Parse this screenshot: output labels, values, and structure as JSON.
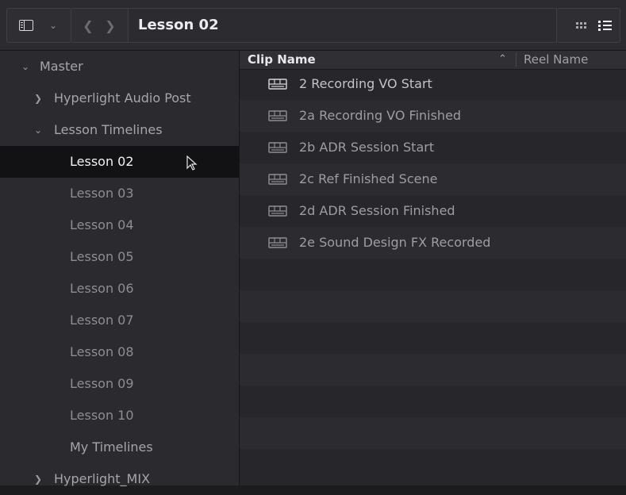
{
  "toolbar": {
    "title": "Lesson 02",
    "icons": [
      "panel-toggle-icon",
      "chevron-down-icon",
      "back-icon",
      "forward-icon",
      "grid-view-icon",
      "list-view-icon"
    ]
  },
  "sidebar": {
    "master": "Master",
    "hyperlight_audio_post": "Hyperlight Audio Post",
    "lesson_timelines": "Lesson Timelines",
    "lessons": [
      "Lesson 02",
      "Lesson 03",
      "Lesson 04",
      "Lesson 05",
      "Lesson 06",
      "Lesson 07",
      "Lesson 08",
      "Lesson 09",
      "Lesson 10"
    ],
    "my_timelines": "My Timelines",
    "hyperlight_mix": "Hyperlight_MIX",
    "selected": "Lesson 02"
  },
  "columns": {
    "clip_name": "Clip Name",
    "reel_name": "Reel Name"
  },
  "clips": [
    "2 Recording VO Start",
    "2a Recording VO Finished",
    "2b ADR Session Start",
    "2c Ref Finished Scene",
    "2d ADR Session Finished",
    "2e Sound Design FX Recorded"
  ]
}
